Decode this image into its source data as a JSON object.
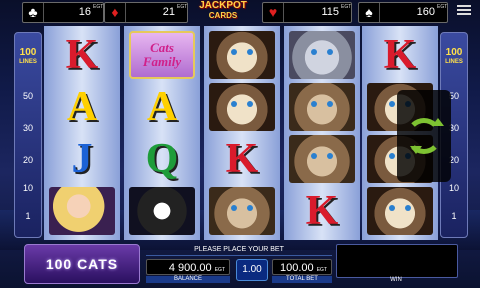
{
  "jackpots": [
    {
      "suit": "clubs",
      "symbol": "♣",
      "amount": "16 650.00",
      "currency": "EGT",
      "color": "#ffffff"
    },
    {
      "suit": "diamonds",
      "symbol": "♦",
      "amount": "21 061.00",
      "currency": "EGT",
      "color": "#e02020"
    },
    {
      "suit": "hearts",
      "symbol": "♥",
      "amount": "115 138.00",
      "currency": "EGT",
      "color": "#e02020"
    },
    {
      "suit": "spades",
      "symbol": "♠",
      "amount": "160 666.00",
      "currency": "EGT",
      "color": "#ffffff"
    }
  ],
  "jackpot_logo": {
    "line1": "JACKPOT",
    "line2": "CARDS"
  },
  "lines_left": {
    "count": "100",
    "label": "LINES",
    "marks": [
      "50",
      "30",
      "20",
      "10",
      "1"
    ]
  },
  "lines_right": {
    "count": "100",
    "label": "LINES",
    "marks": [
      "50",
      "30",
      "20",
      "10",
      "1"
    ]
  },
  "reels": [
    [
      "K",
      "A",
      "J",
      "blonde-lady"
    ],
    [
      "cats-family-logo",
      "A",
      "Q",
      "persian-cat"
    ],
    [
      "siamese-cat",
      "siamese-cat",
      "K",
      "tabby-cat"
    ],
    [
      "grey-cat",
      "tabby-cat",
      "tabby-cat",
      "K"
    ],
    [
      "K",
      "siamese-cat",
      "siamese-cat",
      "siamese-cat"
    ]
  ],
  "logo_symbol_text": "Cats Family",
  "game_logo": "100 CATS",
  "message": "PLEASE PLACE YOUR BET",
  "balance": {
    "value": "4 900.00",
    "currency": "EGT",
    "label": "BALANCE"
  },
  "denomination": "1.00",
  "total_bet": {
    "value": "100.00",
    "currency": "EGT",
    "label": "TOTAL BET"
  },
  "win": {
    "value": "",
    "label": "WIN"
  },
  "colors": {
    "accent": "#7ec232",
    "card_k": "#d91b2c",
    "card_a": "#ffd000",
    "card_j": "#1c62d6",
    "card_q": "#1e9c3a"
  }
}
